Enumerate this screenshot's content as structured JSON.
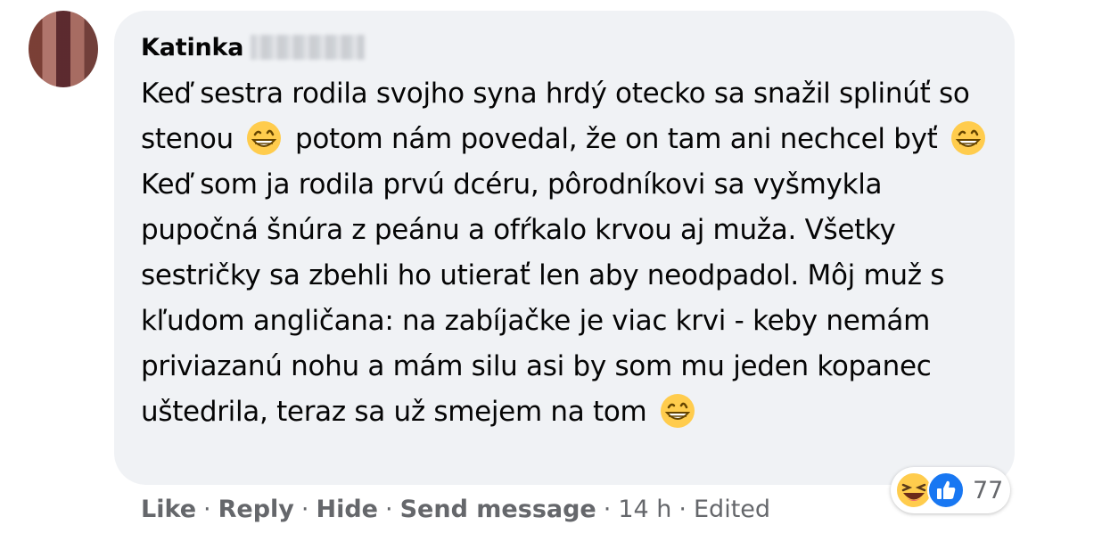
{
  "comment": {
    "author": "Katinka",
    "paragraphs": [
      {
        "segments": [
          {
            "type": "text",
            "value": "Keď sestra rodila svojho syna hrdý otecko sa snažil splinúť so stenou "
          },
          {
            "type": "emoji",
            "name": "grinning-face-icon"
          },
          {
            "type": "text",
            "value": " potom nám povedal, že on tam ani nechcel byť "
          },
          {
            "type": "emoji",
            "name": "grinning-face-icon"
          }
        ]
      },
      {
        "segments": [
          {
            "type": "text",
            "value": "Keď som ja rodila prvú dcéru, pôrodníkovi sa vyšmykla pupočná šnúra z peánu a ofŕkalo krvou aj muža. Všetky sestričky sa zbehli ho utierať len aby neodpadol. Môj muž s kľudom angličana: na zabíjačke je viac krvi - keby nemám priviazanú nohu a mám silu asi by som mu jeden kopanec uštedrila, teraz sa už smejem na tom "
          },
          {
            "type": "emoji",
            "name": "grinning-face-icon"
          }
        ]
      }
    ]
  },
  "reactions": {
    "icons": [
      "laughing-reaction-icon",
      "like-reaction-icon"
    ],
    "count": "77"
  },
  "actions": {
    "like": "Like",
    "reply": "Reply",
    "hide": "Hide",
    "send_message": "Send message",
    "time": "14 h",
    "edited": "Edited",
    "separator": "·"
  },
  "colors": {
    "bubble": "#f0f2f5",
    "text": "#050505",
    "secondary": "#65676b",
    "like_blue": "#1877f2",
    "emoji_yellow": "#ffcc4d"
  }
}
